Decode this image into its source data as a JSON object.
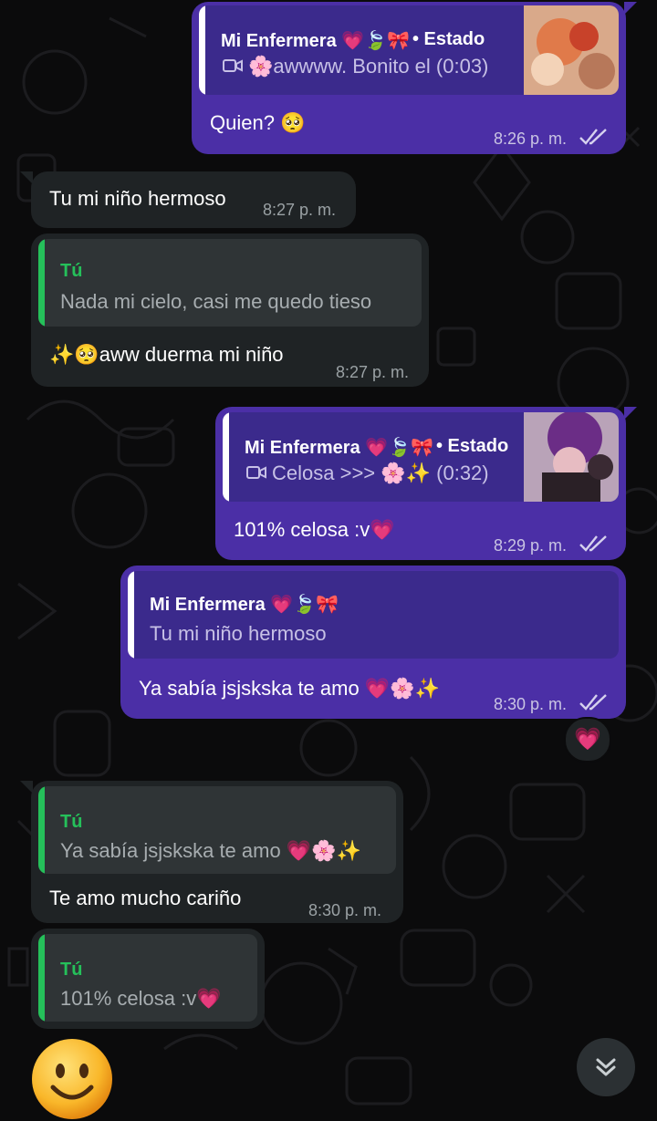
{
  "messages": [
    {
      "id": "m1",
      "direction": "out",
      "quote": {
        "author": "Mi Enfermera 💗🍃🎀",
        "suffix": "• Estado",
        "media_icon": "video-icon",
        "text": "🌸awwww. Bonito el (0:03)"
      },
      "text": "Quien? 🥺",
      "time": "8:26 p. m.",
      "status": "read"
    },
    {
      "id": "m2",
      "direction": "in",
      "text": "Tu mi niño hermoso",
      "time": "8:27 p. m."
    },
    {
      "id": "m3",
      "direction": "in",
      "quote": {
        "author": "Tú",
        "text": "Nada mi cielo, casi me quedo tieso"
      },
      "text": "✨🥺aww duerma mi niño",
      "time": "8:27 p. m."
    },
    {
      "id": "m4",
      "direction": "out",
      "quote": {
        "author": "Mi Enfermera 💗🍃🎀",
        "suffix": "• Estado",
        "media_icon": "video-icon",
        "text": "Celosa >>> 🌸✨ (0:32)"
      },
      "text": "101% celosa :v💗",
      "time": "8:29 p. m.",
      "status": "read"
    },
    {
      "id": "m5",
      "direction": "out",
      "quote": {
        "author": "Mi Enfermera 💗🍃🎀",
        "text": "Tu mi niño hermoso"
      },
      "text": "Ya sabía jsjskska te amo 💗🌸✨",
      "time": "8:30 p. m.",
      "status": "read",
      "reaction": "💗"
    },
    {
      "id": "m6",
      "direction": "in",
      "quote": {
        "author": "Tú",
        "text": "Ya sabía jsjskska te amo 💗🌸✨"
      },
      "text": "Te amo mucho cariño",
      "time": "8:30 p. m."
    },
    {
      "id": "m7",
      "direction": "in",
      "quote": {
        "author": "Tú",
        "text": "101% celosa :v💗"
      }
    }
  ],
  "colors": {
    "outgoing": "#4b2fa6",
    "incoming": "#1f2325",
    "reply_bar_in": "#25c05a",
    "background": "#0b0b0c"
  },
  "icons": {
    "read_status": "double-check-icon",
    "scroll": "chevron-double-down-icon",
    "sticker": "smiley-sticker"
  }
}
